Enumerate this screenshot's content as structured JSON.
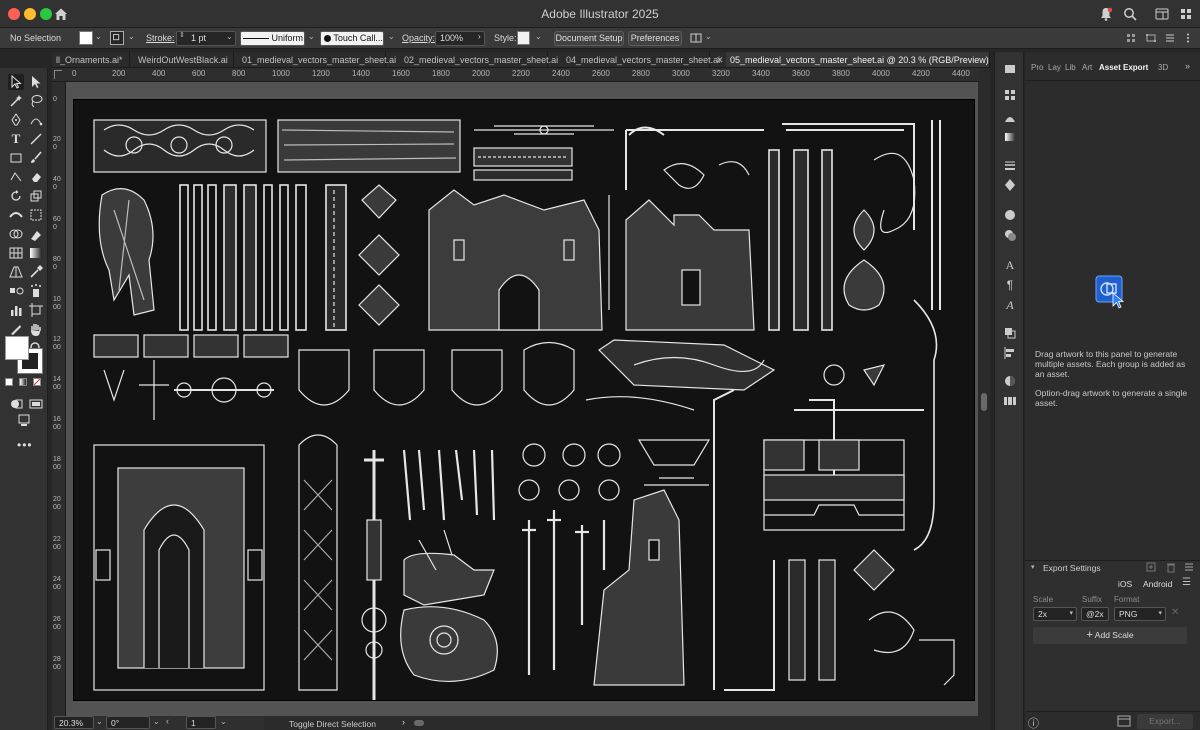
{
  "app": {
    "title": "Adobe Illustrator 2025"
  },
  "controlbar": {
    "selection": "No Selection",
    "stroke_label": "Stroke:",
    "stroke_value": "1 pt",
    "profile": "Uniform",
    "brush": "Touch Call...",
    "opacity_label": "Opacity:",
    "opacity_value": "100%",
    "style_label": "Style:",
    "document_setup": "Document Setup",
    "preferences": "Preferences"
  },
  "tabs": [
    {
      "label": "ll_Ornaments.ai*"
    },
    {
      "label": "WeirdOutWestBlack.ai"
    },
    {
      "label": "01_medieval_vectors_master_sheet.ai"
    },
    {
      "label": "02_medieval_vectors_master_sheet.ai"
    },
    {
      "label": "04_medieval_vectors_master_sheet.ai"
    },
    {
      "label": "05_medieval_vectors_master_sheet.ai @ 20.3 % (RGB/Preview)"
    }
  ],
  "ruler": {
    "h_ticks": [
      "0",
      "200",
      "400",
      "600",
      "800",
      "1000",
      "1200",
      "1400",
      "1600",
      "1800",
      "2000",
      "2200",
      "2400",
      "2600",
      "2800",
      "3000",
      "3200",
      "3400",
      "3600",
      "3800",
      "4000",
      "4200",
      "4400"
    ],
    "v_ticks": [
      "0",
      "200",
      "400",
      "600",
      "800",
      "1000",
      "1200",
      "1400",
      "1600",
      "1800",
      "2000",
      "2200",
      "2400",
      "2600",
      "2800"
    ]
  },
  "status": {
    "zoom": "20.3%",
    "rotation": "0°",
    "artboard": "1",
    "tool_hint": "Toggle Direct Selection"
  },
  "panel": {
    "tabs": [
      "Pro",
      "Lay",
      "Lib",
      "Art",
      "Asset Export",
      "3D"
    ],
    "hint1": "Drag artwork to this panel to generate multiple assets. Each group is added as an asset.",
    "hint2": "Option-drag artwork to generate a single asset.",
    "export_settings": "Export Settings",
    "ios": "iOS",
    "android": "Android",
    "scale_label": "Scale",
    "suffix_label": "Suffix",
    "format_label": "Format",
    "scale": "2x",
    "suffix": "@2x",
    "format": "PNG",
    "add_scale": "Add Scale",
    "export_button": "Export..."
  },
  "colors": {
    "accent": "#2d7ff9",
    "artboard": "#121212",
    "art": "#e6e6e6"
  }
}
